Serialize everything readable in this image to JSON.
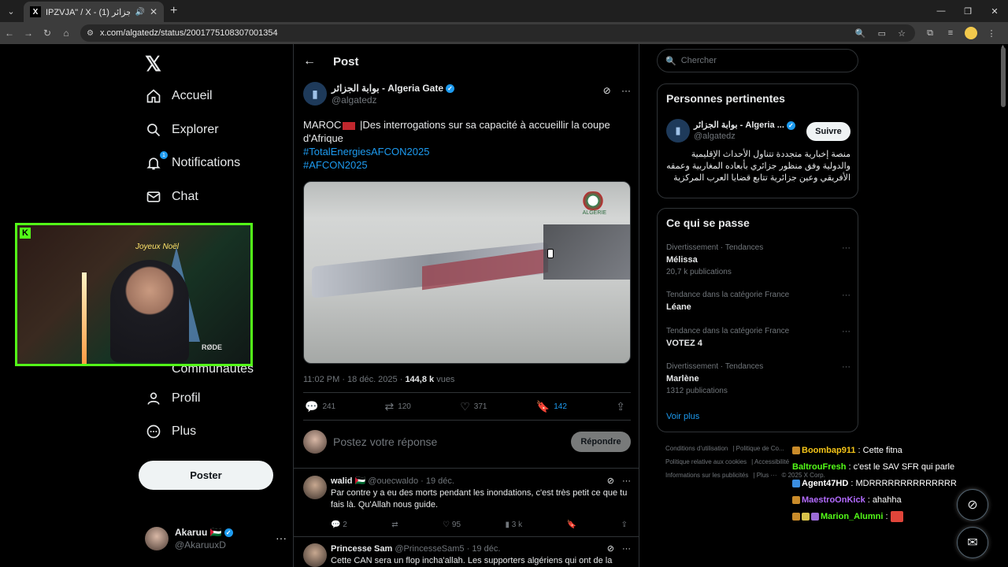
{
  "browser": {
    "tab_title": "IPZVJA\" / X - بوابة الجزائر (1)",
    "url": "x.com/algatedz/status/2001775108307001354"
  },
  "nav": {
    "items": [
      {
        "label": "Accueil",
        "icon": "home-icon"
      },
      {
        "label": "Explorer",
        "icon": "search-icon"
      },
      {
        "label": "Notifications",
        "icon": "bell-icon",
        "badge": "1"
      },
      {
        "label": "Chat",
        "icon": "mail-icon"
      },
      {
        "label": "Profil",
        "icon": "person-icon"
      },
      {
        "label": "Plus",
        "icon": "more-circle-icon"
      }
    ],
    "hidden_label": "Communautés",
    "post_button": "Poster",
    "account": {
      "name": "Akaruu 🇵🇸",
      "handle": "@AkaruuxD"
    }
  },
  "post": {
    "header_title": "Post",
    "author_name": "بوابة الجزائر - Algeria Gate",
    "author_handle": "@algatedz",
    "text_prefix": "MAROC",
    "text_suffix": " |Des interrogations sur sa capacité à accueillir la coupe d'Afrique",
    "hashtags": [
      "#TotalEnergiesAFCON2025",
      "#AFCON2025"
    ],
    "media_logo_text": "ALGERIE",
    "timestamp": "11:02 PM · 18 déc. 2025 · ",
    "views_count": "144,8 k",
    "views_label": " vues",
    "stats": {
      "replies": "241",
      "reposts": "120",
      "likes": "371",
      "bookmarks": "142"
    }
  },
  "reply_composer": {
    "placeholder": "Postez votre réponse",
    "button": "Répondre"
  },
  "replies": [
    {
      "name": "walid 🇵🇸",
      "handle": "@ouecwaldo · 19 déc.",
      "text": "Par contre y a eu des morts pendant les inondations, c'est très petit ce que tu fais là. Qu'Allah nous guide.",
      "replies": "2",
      "likes": "95",
      "views": "3 k"
    },
    {
      "name": "Princesse Sam",
      "handle": "@PrincesseSam5 · 19 déc.",
      "text": "Cette CAN sera un flop incha'allah. Les supporters algériens qui ont de la"
    }
  ],
  "right": {
    "search_placeholder": "Chercher",
    "related_title": "Personnes pertinentes",
    "related": {
      "name": "بوابة الجزائر - Algeria ...",
      "handle": "@algatedz",
      "follow": "Suivre",
      "bio": "منصة إخبارية متجددة تتناول الأحداث الإقليمية والدولية وفق منظور جزائري بأبعاده المغاربية وعمقه الأفريقي وعين جزائرية تتابع قضايا العرب المركزية"
    },
    "trends_title": "Ce qui se passe",
    "trends": [
      {
        "category": "Divertissement · Tendances",
        "name": "Mélissa",
        "count": "20,7 k publications"
      },
      {
        "category": "Tendance dans la catégorie France",
        "name": "Léane",
        "count": ""
      },
      {
        "category": "Tendance dans la catégorie France",
        "name": "VOTEZ 4",
        "count": ""
      },
      {
        "category": "Divertissement · Tendances",
        "name": "Marlène",
        "count": "1312 publications"
      }
    ],
    "show_more": "Voir plus",
    "footer": [
      [
        "Conditions d'utilisation",
        "Politique de Co..."
      ],
      [
        "Politique relative aux cookies",
        "Accessibilité"
      ],
      [
        "Informations sur les publicités",
        "Plus ···",
        "© 2025 X Corp."
      ]
    ]
  },
  "chat": [
    {
      "user": "Boombap911",
      "msg": ": Cette fitna",
      "color": "#f5c518"
    },
    {
      "user": "BaltrouFresh",
      "msg": ": c'est le SAV SFR qui parle",
      "color": "#53fc18"
    },
    {
      "user": "Agent47HD",
      "msg": ": MDRRRRRRRRRRRRRR",
      "color": "#ffffff"
    },
    {
      "user": "MaestroOnKick",
      "msg": ": ahahha",
      "color": "#b36bff"
    },
    {
      "user": "Marion_Alumni",
      "msg": ":",
      "color": "#53fc18"
    }
  ],
  "webcam": {
    "neon_text": "Joyeux Noël",
    "mic_brand": "RØDE"
  }
}
